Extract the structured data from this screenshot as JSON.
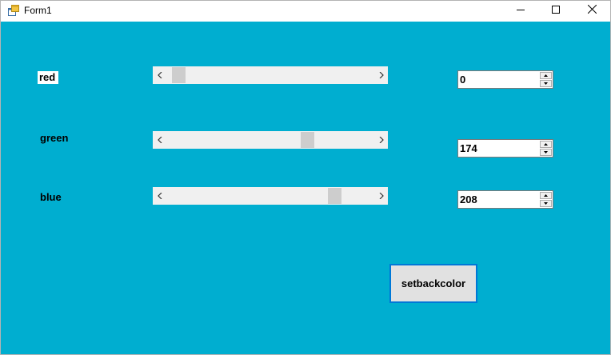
{
  "window": {
    "title": "Form1",
    "icon": "winforms-app-icon",
    "minimize_icon": "minimize-icon",
    "maximize_icon": "maximize-icon",
    "close_icon": "close-icon"
  },
  "colors": {
    "client_background": "#00AED0",
    "scrollbar_track": "#F0F0F0",
    "scrollbar_thumb": "#CDCDCD",
    "button_face": "#E1E1E1",
    "button_focus_border": "#0078D7"
  },
  "channels": [
    {
      "label": "red",
      "value": "0",
      "scroll_fraction": 0.03
    },
    {
      "label": "green",
      "value": "174",
      "scroll_fraction": 0.69
    },
    {
      "label": "blue",
      "value": "208",
      "scroll_fraction": 0.83
    }
  ],
  "button": {
    "label": "setbackcolor"
  }
}
